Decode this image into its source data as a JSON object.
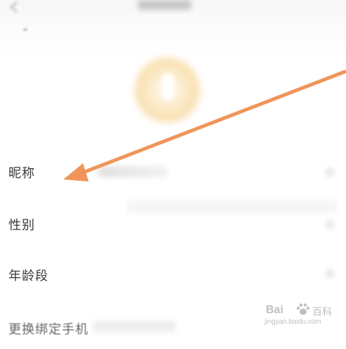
{
  "rows": [
    {
      "key": "nickname",
      "label": "昵称"
    },
    {
      "key": "gender",
      "label": "性别"
    },
    {
      "key": "age",
      "label": "年龄段"
    },
    {
      "key": "phone",
      "label": "更换绑定手机"
    }
  ],
  "colors": {
    "arrow": "#F0955A",
    "label": "#3A3A3A",
    "avatar": "#F5D69A"
  },
  "watermark": {
    "logo": "Bai",
    "logo_tail": "百科",
    "url": "jingyan.baidu.com"
  },
  "icons": {
    "back": "chevron-left-icon",
    "row_arrow": "chevron-right-icon",
    "annotation": "annotation-arrow"
  }
}
